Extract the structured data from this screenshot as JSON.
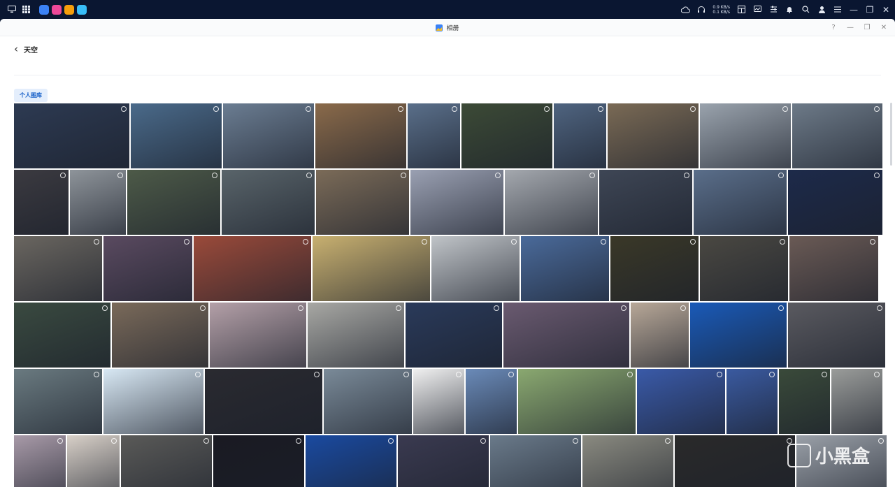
{
  "taskbar": {
    "upload_speed": "0.9 KB/s",
    "download_speed": "0.1 KB/s",
    "apps": [
      {
        "name": "app-store",
        "color": "#3b82f6"
      },
      {
        "name": "photos",
        "color": "#ec4899"
      },
      {
        "name": "notes",
        "color": "#f59e0b"
      },
      {
        "name": "gallery",
        "color": "#38bdf8"
      }
    ]
  },
  "window": {
    "title": "相册",
    "album_title": "天空",
    "tab_label": "个人图库"
  },
  "watermark": {
    "text": "小黑盒"
  },
  "photo_rows": [
    [
      {
        "w": 165,
        "c": "#2d3a52"
      },
      {
        "w": 130,
        "c": "#4a6a8a"
      },
      {
        "w": 130,
        "c": "#6b7d92"
      },
      {
        "w": 130,
        "c": "#8a6a4a"
      },
      {
        "w": 75,
        "c": "#5a6f8a"
      },
      {
        "w": 130,
        "c": "#3c4a36"
      },
      {
        "w": 75,
        "c": "#4f6480"
      },
      {
        "w": 130,
        "c": "#7a6a55"
      },
      {
        "w": 130,
        "c": "#9aa3ad"
      },
      {
        "w": 129,
        "c": "#6d7a88"
      }
    ],
    [
      {
        "w": 78,
        "c": "#3b3a40"
      },
      {
        "w": 80,
        "c": "#8e949a"
      },
      {
        "w": 133,
        "c": "#4d5a48"
      },
      {
        "w": 133,
        "c": "#59646a"
      },
      {
        "w": 133,
        "c": "#7b6b58"
      },
      {
        "w": 133,
        "c": "#9aa0b2"
      },
      {
        "w": 133,
        "c": "#a4a8ae"
      },
      {
        "w": 133,
        "c": "#3e4655"
      },
      {
        "w": 133,
        "c": "#5a6e8a"
      },
      {
        "w": 135,
        "c": "#1d2a4a"
      }
    ],
    [
      {
        "w": 126,
        "c": "#6a6660"
      },
      {
        "w": 127,
        "c": "#5a4a60"
      },
      {
        "w": 168,
        "c": "#9a4a3a"
      },
      {
        "w": 168,
        "c": "#c8b070"
      },
      {
        "w": 126,
        "c": "#c0c4c8"
      },
      {
        "w": 126,
        "c": "#4a6a9a"
      },
      {
        "w": 126,
        "c": "#3a3828"
      },
      {
        "w": 126,
        "c": "#4a4842"
      },
      {
        "w": 127,
        "c": "#6a5a55"
      }
    ],
    [
      {
        "w": 138,
        "c": "#3a4a40"
      },
      {
        "w": 138,
        "c": "#7a6a5a"
      },
      {
        "w": 138,
        "c": "#b4a0a8"
      },
      {
        "w": 138,
        "c": "#a8a8a4"
      },
      {
        "w": 138,
        "c": "#2a3a5a"
      },
      {
        "w": 180,
        "c": "#6a5a70"
      },
      {
        "w": 83,
        "c": "#b8a898"
      },
      {
        "w": 138,
        "c": "#1a5ab8"
      },
      {
        "w": 139,
        "c": "#5a5a60"
      }
    ],
    [
      {
        "w": 126,
        "c": "#6a7a80"
      },
      {
        "w": 143,
        "c": "#d8e8f4"
      },
      {
        "w": 168,
        "c": "#2a2a30"
      },
      {
        "w": 126,
        "c": "#7a8a98"
      },
      {
        "w": 73,
        "c": "#f0f0f0"
      },
      {
        "w": 73,
        "c": "#6a8ab8"
      },
      {
        "w": 168,
        "c": "#8aa870"
      },
      {
        "w": 126,
        "c": "#3a5aa8"
      },
      {
        "w": 73,
        "c": "#3a5aa0"
      },
      {
        "w": 73,
        "c": "#3a4a3a"
      },
      {
        "w": 73,
        "c": "#9a9c9a"
      }
    ],
    [
      {
        "w": 74,
        "c": "#a89aa8"
      },
      {
        "w": 75,
        "c": "#d8d0c8"
      },
      {
        "w": 130,
        "c": "#5a5a58"
      },
      {
        "w": 130,
        "c": "#1a1a22"
      },
      {
        "w": 130,
        "c": "#1a4aa0"
      },
      {
        "w": 130,
        "c": "#3a3a50"
      },
      {
        "w": 130,
        "c": "#6a7a8a"
      },
      {
        "w": 130,
        "c": "#8a8a80"
      },
      {
        "w": 172,
        "c": "#2a2a2a"
      },
      {
        "w": 129,
        "c": "#9aa0a8"
      }
    ]
  ]
}
